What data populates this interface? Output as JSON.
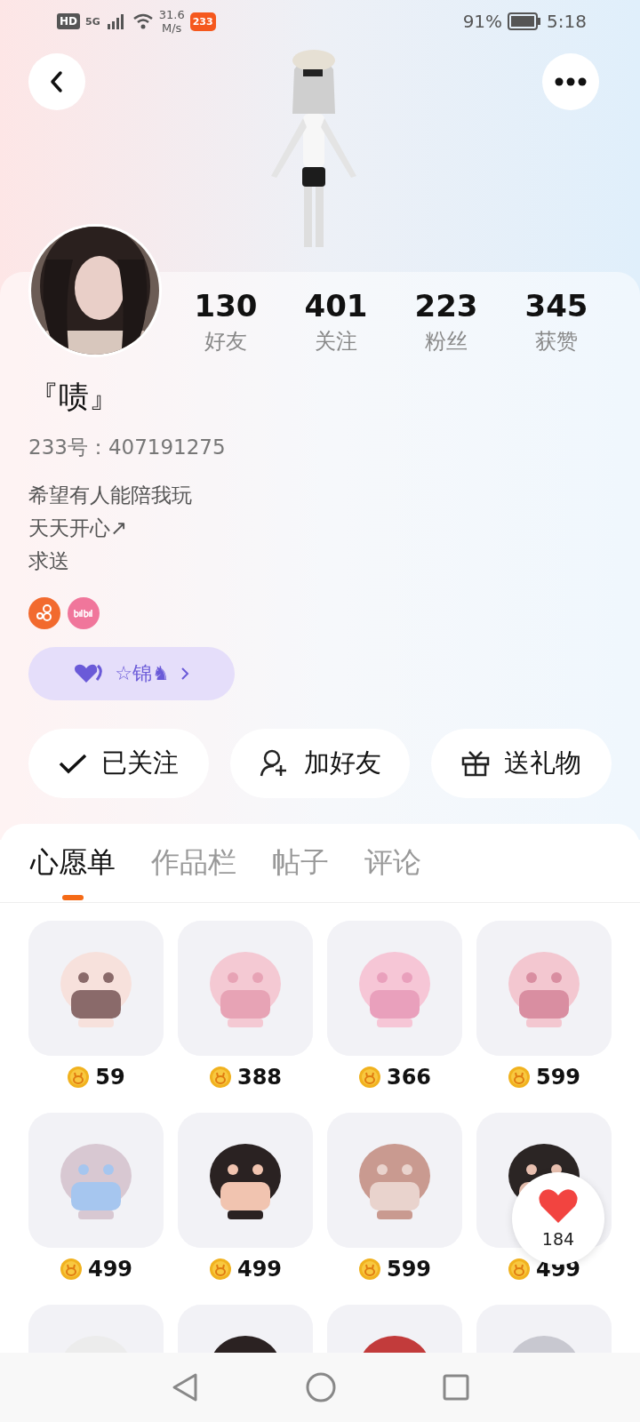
{
  "status_bar": {
    "hd": "HD",
    "network": "5G",
    "speed": [
      "31.6",
      "M/s"
    ],
    "app_badge": "233",
    "battery": "91%",
    "time": "5:18"
  },
  "stats": [
    {
      "value": "130",
      "label": "好友"
    },
    {
      "value": "401",
      "label": "关注"
    },
    {
      "value": "223",
      "label": "粉丝"
    },
    {
      "value": "345",
      "label": "获赞"
    }
  ],
  "profile": {
    "name": "『啧』",
    "id": "233号：407191275",
    "bio": [
      "希望有人能陪我玩",
      "天天开心↗",
      "求送"
    ],
    "relation_tag": "☆锦♞"
  },
  "actions": [
    {
      "kind": "followed",
      "label": "已关注"
    },
    {
      "kind": "add_friend",
      "label": "加好友"
    },
    {
      "kind": "gift",
      "label": "送礼物"
    }
  ],
  "tabs": [
    {
      "label": "心愿单",
      "selected": true
    },
    {
      "label": "作品栏",
      "selected": false
    },
    {
      "label": "帖子",
      "selected": false
    },
    {
      "label": "评论",
      "selected": false
    }
  ],
  "wishlist": [
    {
      "price": "59"
    },
    {
      "price": "388"
    },
    {
      "price": "366"
    },
    {
      "price": "599"
    },
    {
      "price": "499"
    },
    {
      "price": "499"
    },
    {
      "price": "599"
    },
    {
      "price": "499"
    },
    {
      "kind": "picture"
    },
    {
      "kind": "picture"
    },
    {
      "kind": "picture"
    },
    {
      "kind": "picture"
    }
  ],
  "like_button": {
    "count": "184"
  }
}
